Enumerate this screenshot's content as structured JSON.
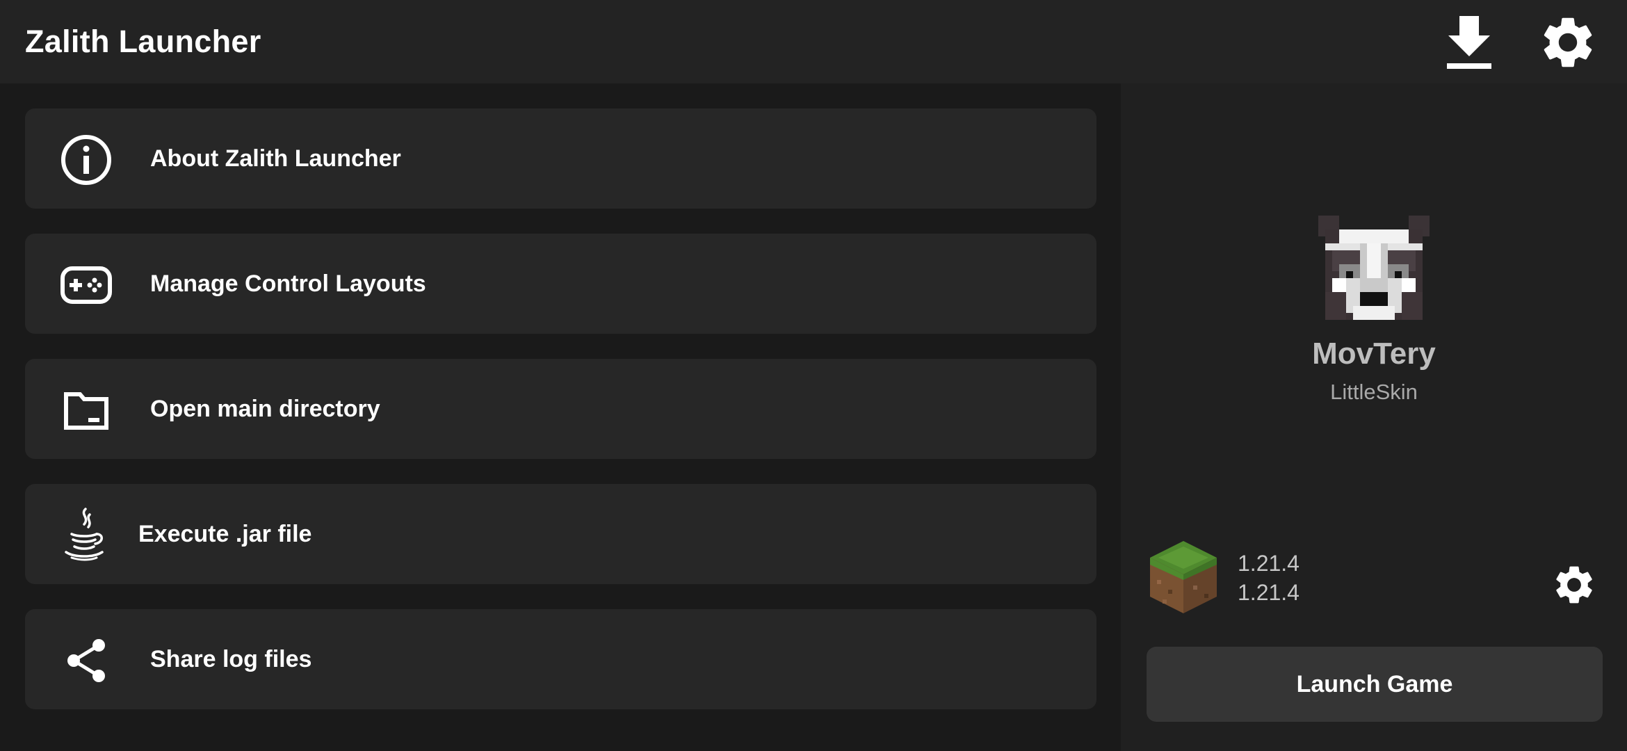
{
  "app": {
    "title": "Zalith Launcher"
  },
  "topbar": {
    "download_icon": "download-icon",
    "settings_icon": "gear-icon"
  },
  "menu": {
    "items": [
      {
        "label": "About Zalith Launcher",
        "icon": "info-icon"
      },
      {
        "label": "Manage Control Layouts",
        "icon": "gamepad-icon"
      },
      {
        "label": "Open main directory",
        "icon": "folder-icon"
      },
      {
        "label": "Execute .jar file",
        "icon": "java-icon"
      },
      {
        "label": "Share log files",
        "icon": "share-icon"
      }
    ]
  },
  "account": {
    "username": "MovTery",
    "type": "LittleSkin",
    "avatar_icon": "player-head-avatar"
  },
  "version": {
    "name": "1.21.4",
    "game_version": "1.21.4",
    "icon": "grass-block-icon",
    "settings_icon": "gear-icon"
  },
  "launch": {
    "label": "Launch Game"
  },
  "colors": {
    "topbar_bg": "#232323",
    "page_bg": "#1a1a1a",
    "card_bg": "#272727",
    "panel_bg": "#202020",
    "button_bg": "#353535"
  }
}
